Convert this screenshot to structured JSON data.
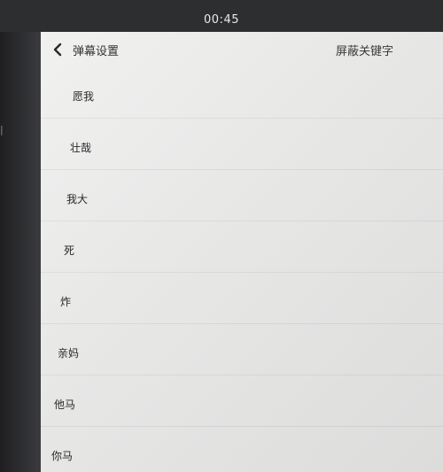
{
  "status_bar": {
    "time": "00:45"
  },
  "nav": {
    "back_label": "弹幕设置",
    "title": "屏蔽关键字",
    "back_icon": "chevron-left-icon"
  },
  "keywords": [
    "愿我",
    "壮哉",
    "我大",
    "死",
    "炸",
    "亲妈",
    "他马",
    "你马"
  ]
}
